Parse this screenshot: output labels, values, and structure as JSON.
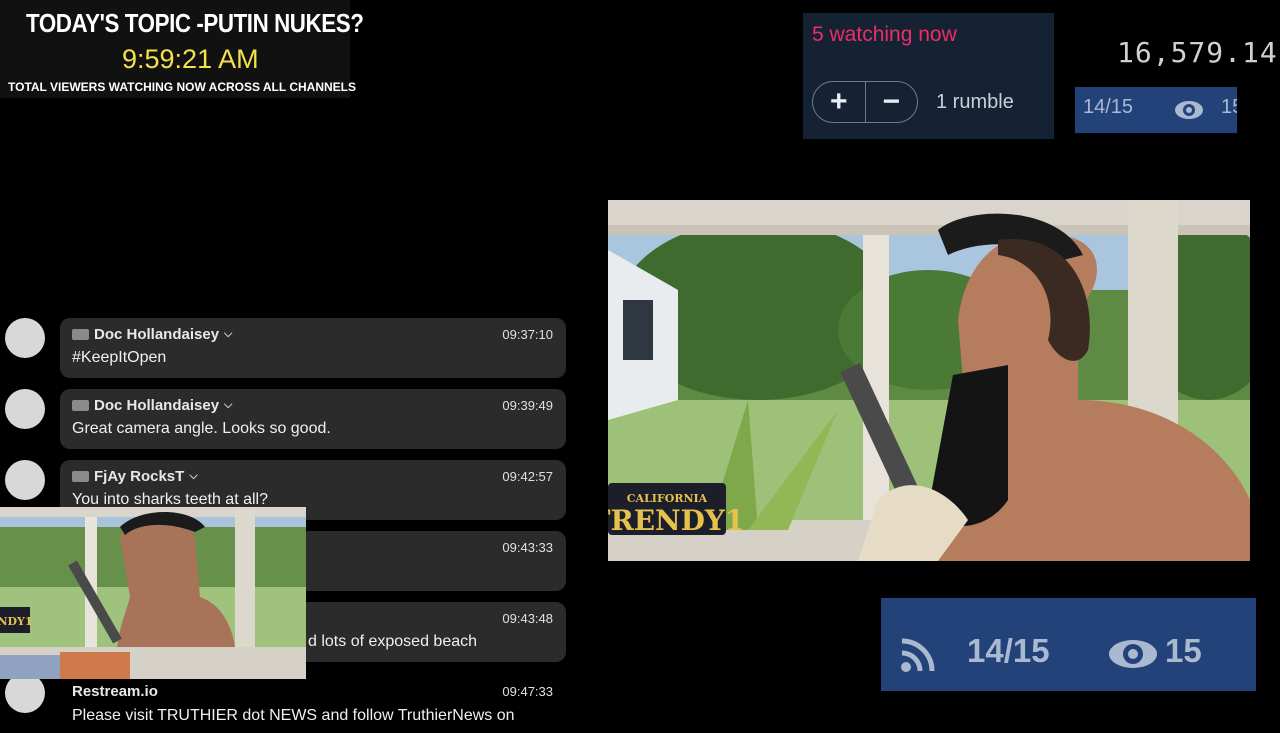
{
  "banner": {
    "title": "TODAY'S TOPIC -PUTIN NUKES?",
    "time": "9:59:21 AM",
    "subtitle": "TOTAL VIEWERS WATCHING NOW ACROSS ALL CHANNELS"
  },
  "rumble": {
    "watching": "5 watching now",
    "upvote_label": "+",
    "downvote_label": "−",
    "rumbles": "1 rumble"
  },
  "counter": "16,579.14",
  "small_stats": {
    "ratio": "14/15",
    "viewers": "15"
  },
  "big_stats": {
    "ratio": "14/15",
    "viewers": "15"
  },
  "chat": [
    {
      "name": "Doc Hollandaisey",
      "time": "09:37:10",
      "text": "#KeepItOpen"
    },
    {
      "name": "Doc Hollandaisey",
      "time": "09:39:49",
      "text": "Great camera angle. Looks so good."
    },
    {
      "name": "FjAy RocksT",
      "time": "09:42:57",
      "text": "You into sharks teeth at all?"
    },
    {
      "name": "",
      "time": "09:43:33",
      "text": ""
    },
    {
      "name": "",
      "time": "09:43:48",
      "text": "d lots of exposed beach"
    },
    {
      "name": "Restream.io",
      "time": "09:47:33",
      "text": "Please visit TRUTHIER dot NEWS and follow TruthierNews on"
    }
  ],
  "video": {
    "plate_state": "CALIFORNIA",
    "plate_text": "TRENDY1",
    "pip_plate_text": "NDY1"
  },
  "icons": [
    "rss-icon",
    "eye-icon",
    "plus-icon",
    "minus-icon",
    "chevron-down-icon"
  ],
  "colors": {
    "rumble_bg": "#142234",
    "watching": "#ee2c65",
    "stats_bg": "#23427a",
    "time": "#f4e04a"
  }
}
